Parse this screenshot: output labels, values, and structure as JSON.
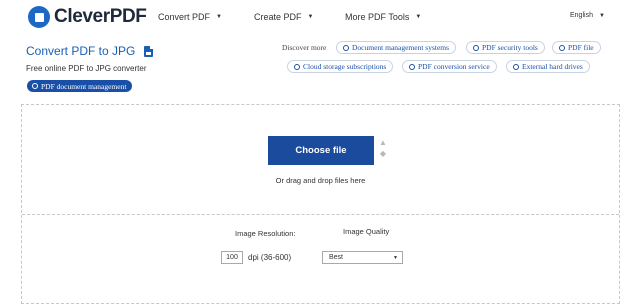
{
  "header": {
    "brand": "CleverPDF",
    "nav": [
      {
        "label": "Convert PDF"
      },
      {
        "label": "Create PDF"
      },
      {
        "label": "More PDF Tools"
      }
    ],
    "language": "English",
    "caret": "▼"
  },
  "title_area": {
    "title": "Convert PDF to JPG",
    "subtitle": "Free online PDF to JPG converter",
    "badge": "PDF document management"
  },
  "discover": {
    "label": "Discover more",
    "links": [
      "Document management systems",
      "PDF security tools",
      "PDF file",
      "Cloud storage subscriptions",
      "PDF conversion service",
      "External hard drives"
    ]
  },
  "upload": {
    "button_label": "Choose file",
    "drop_text": "Or drag and drop files here"
  },
  "options": {
    "resolution_label": "Image Resolution:",
    "quality_label": "Image Quality",
    "dpi_value": "100",
    "dpi_unit": "dpi (36-600)",
    "quality_value": "Best"
  }
}
